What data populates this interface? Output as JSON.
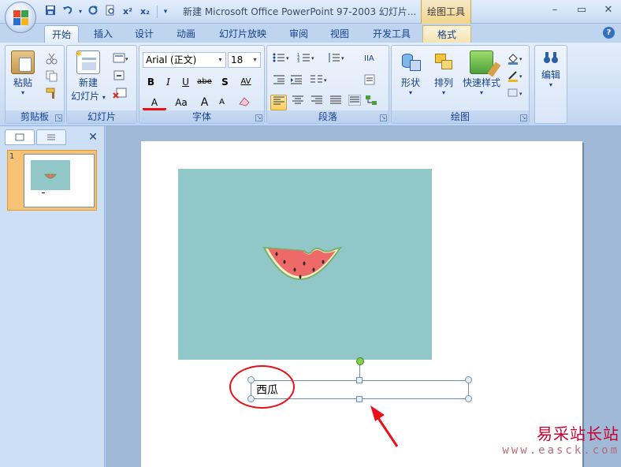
{
  "window": {
    "title": "新建 Microsoft Office PowerPoint 97-2003 幻灯片...",
    "context_tool": "绘图工具"
  },
  "quick_access": {
    "icons": [
      "save-icon",
      "undo-icon",
      "dropdown-icon",
      "redo-icon",
      "print-preview-icon",
      "superscript-icon",
      "subscript-icon",
      "customize-icon"
    ],
    "superscript": "x²",
    "subscript": "x₂"
  },
  "tabs": [
    {
      "label": "开始",
      "active": true
    },
    {
      "label": "插入"
    },
    {
      "label": "设计"
    },
    {
      "label": "动画"
    },
    {
      "label": "幻灯片放映"
    },
    {
      "label": "审阅"
    },
    {
      "label": "视图"
    },
    {
      "label": "开发工具"
    },
    {
      "label": "格式",
      "context": true
    }
  ],
  "ribbon": {
    "clipboard": {
      "label": "剪贴板",
      "paste": "粘贴"
    },
    "slides": {
      "label": "幻灯片",
      "new_slide_line1": "新建",
      "new_slide_line2": "幻灯片"
    },
    "font": {
      "label": "字体",
      "family": "Arial (正文)",
      "size": "18",
      "bold": "B",
      "italic": "I",
      "underline": "U",
      "strike": "abe",
      "shadow": "S",
      "spacing": "AV",
      "font_color": "A",
      "change_case": "Aa",
      "grow": "A",
      "shrink": "A"
    },
    "paragraph": {
      "label": "段落"
    },
    "drawing": {
      "label": "绘图",
      "shapes": "形状",
      "arrange": "排列",
      "quick_styles": "快速样式"
    },
    "editing": {
      "label": "编辑",
      "edit": "编辑"
    }
  },
  "left_pane": {
    "tabs": [
      "slides-tab",
      "outline-tab"
    ],
    "slide_number": "1"
  },
  "slide": {
    "textbox_text": "西瓜",
    "picture_desc": "watermelon"
  },
  "watermark": {
    "title": "易采站长站",
    "url": "www.easck.com"
  },
  "colors": {
    "picture_bg": "#91c7c9",
    "annotation_red": "#e8111a",
    "ribbon_bg": "#cfdff4"
  }
}
